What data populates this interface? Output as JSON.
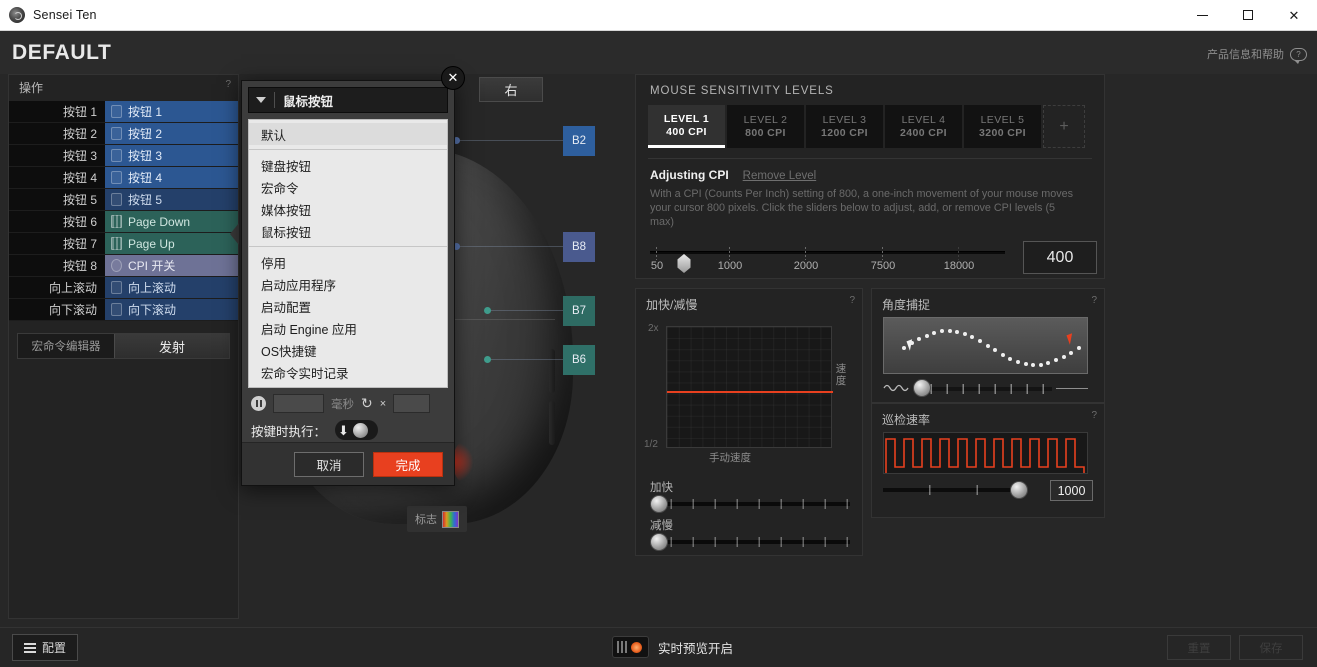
{
  "window": {
    "title": "Sensei Ten",
    "app_icon": "sensei-logo-icon",
    "minimize": "—",
    "maximize": "□",
    "close": "✕"
  },
  "header": {
    "profile_name": "DEFAULT",
    "help_label": "产品信息和帮助",
    "help_icon": "speech-bubble-question-icon"
  },
  "operations": {
    "title": "操作",
    "help_marker": "?",
    "rows": [
      {
        "key": "按钮 1",
        "value": "按钮 1",
        "style": "blue",
        "icon": "mouse-icon"
      },
      {
        "key": "按钮 2",
        "value": "按钮 2",
        "style": "blue",
        "icon": "mouse-icon"
      },
      {
        "key": "按钮 3",
        "value": "按钮 3",
        "style": "blue",
        "icon": "mouse-icon"
      },
      {
        "key": "按钮 4",
        "value": "按钮 4",
        "style": "blue",
        "icon": "mouse-icon"
      },
      {
        "key": "按钮 5",
        "value": "按钮 5",
        "style": "blue-d",
        "icon": "mouse-icon"
      },
      {
        "key": "按钮 6",
        "value": "Page Down",
        "style": "teal",
        "icon": "keyboard-icon"
      },
      {
        "key": "按钮 7",
        "value": "Page Up",
        "style": "teal",
        "icon": "keyboard-icon"
      },
      {
        "key": "按钮 8",
        "value": "CPI 开关",
        "style": "lav",
        "icon": "cpi-switch-icon"
      },
      {
        "key": "向上滚动",
        "value": "向上滚动",
        "style": "blue-d",
        "icon": "mouse-icon"
      },
      {
        "key": "向下滚动",
        "value": "向下滚动",
        "style": "blue-d",
        "icon": "mouse-icon"
      }
    ],
    "macro_label": "宏命令编辑器",
    "macro_button": "发射"
  },
  "stage": {
    "side_tab": "右",
    "callouts": [
      {
        "label": "B2",
        "style": "blue"
      },
      {
        "label": "B8",
        "style": "blue2"
      },
      {
        "label": "B7",
        "style": "teal"
      },
      {
        "label": "B6",
        "style": "teal2"
      }
    ],
    "logo_label": "标志",
    "logo_icon": "rgb-swatch-icon"
  },
  "sensitivity": {
    "title": "MOUSE SENSITIVITY LEVELS",
    "levels": [
      {
        "name": "LEVEL 1",
        "cpi": "400 CPI",
        "active": true
      },
      {
        "name": "LEVEL 2",
        "cpi": "800 CPI",
        "active": false
      },
      {
        "name": "LEVEL 3",
        "cpi": "1200 CPI",
        "active": false
      },
      {
        "name": "LEVEL 4",
        "cpi": "2400 CPI",
        "active": false
      },
      {
        "name": "LEVEL 5",
        "cpi": "3200 CPI",
        "active": false
      }
    ],
    "add_level": "+",
    "adjusting_title": "Adjusting CPI",
    "remove_level": "Remove Level",
    "description": "With a CPI (Counts Per Inch) setting of 800, a one-inch movement of your mouse moves your cursor 800 pixels. Click the sliders below to adjust, add, or remove CPI levels (5 max)",
    "tick_labels": [
      "50",
      "1000",
      "2000",
      "7500",
      "18000"
    ],
    "current_value": "400"
  },
  "acceleration": {
    "title": "加快/减慢",
    "help_marker": "?",
    "axis_top": "2x",
    "axis_bottom": "1/2",
    "axis_x": "手动速度",
    "axis_y": "速度",
    "accel_label": "加快",
    "decel_label": "减慢"
  },
  "angle_snapping": {
    "title": "角度捕捉",
    "help_marker": "?",
    "wave_icon": "wave-icon",
    "cursor_icon": "cursor-arrow-icon"
  },
  "polling": {
    "title": "巡检速率",
    "help_marker": "?",
    "value": "1000"
  },
  "bottom_bar": {
    "config_label": "配置",
    "config_icon": "list-icon",
    "live_preview_label": "实时预览开启",
    "live_preview_icon": "led-preview-icon",
    "right_buttons": [
      "重置",
      "保存"
    ]
  },
  "dialog": {
    "close_icon": "close-icon",
    "combo_label": "鼠标按钮",
    "combo_caret_icon": "chevron-down-icon",
    "menu_group_1": [
      {
        "label": "默认",
        "selected": true
      }
    ],
    "menu_group_2": [
      {
        "label": "键盘按钮",
        "selected": false
      },
      {
        "label": "宏命令",
        "selected": false
      },
      {
        "label": "媒体按钮",
        "selected": false
      },
      {
        "label": "鼠标按钮",
        "selected": false
      }
    ],
    "menu_group_3": [
      {
        "label": "停用",
        "selected": false
      },
      {
        "label": "启动应用程序",
        "selected": false
      },
      {
        "label": "启动配置",
        "selected": false
      },
      {
        "label": "启动 Engine 应用",
        "selected": false
      },
      {
        "label": "OS快捷键",
        "selected": false
      },
      {
        "label": "宏命令实时记录",
        "selected": false
      }
    ],
    "delay_icon": "pause-icon",
    "delay_value": "",
    "delay_unit": "毫秒",
    "repeat_icon": "repeat-icon",
    "repeat_times": "×",
    "repeat_value": "",
    "exec_label": "按键时执行：",
    "toggle_icon": "arrow-down-icon",
    "cancel_label": "取消",
    "done_label": "完成"
  },
  "colors": {
    "accent": "#e8401f",
    "active_blue": "#2c5792",
    "teal": "#2c6259",
    "panel_bg": "#232323"
  }
}
